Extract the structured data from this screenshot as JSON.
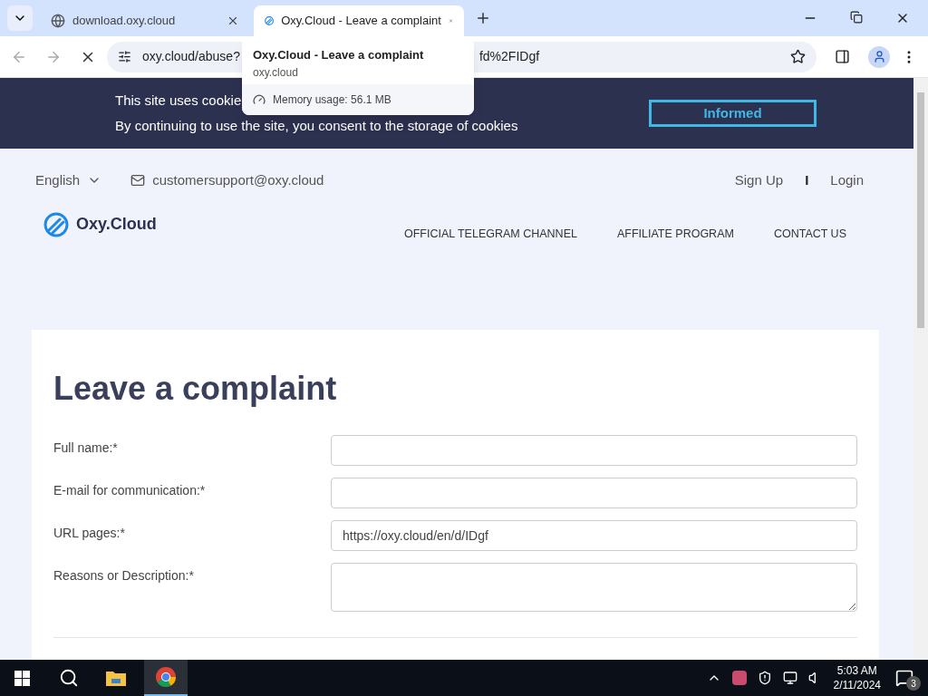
{
  "browser": {
    "tabs": [
      {
        "title": "download.oxy.cloud",
        "selected": false
      },
      {
        "title": "Oxy.Cloud - Leave a complaint",
        "selected": true
      }
    ],
    "address_start": "oxy.cloud/abuse?",
    "address_end": "fd%2FIDgf",
    "tab_preview": {
      "title": "Oxy.Cloud - Leave a complaint",
      "domain": "oxy.cloud",
      "memory": "Memory usage: 56.1 MB"
    }
  },
  "cookie_banner": {
    "line1": "This site uses cookie",
    "line2": "By continuing to use the site, you consent to the storage of cookies",
    "button": "Informed"
  },
  "header": {
    "language": "English",
    "email": "customersupport@oxy.cloud",
    "sign_up": "Sign Up",
    "separator": "I",
    "login": "Login",
    "logo": "Oxy.Cloud",
    "nav": [
      "OFFICIAL TELEGRAM CHANNEL",
      "AFFILIATE PROGRAM",
      "CONTACT US"
    ]
  },
  "form": {
    "title": "Leave a complaint",
    "fields": [
      {
        "label": "Full name:*",
        "kind": "input"
      },
      {
        "label": "E-mail for communication:*",
        "kind": "input"
      },
      {
        "label": "URL pages:*",
        "kind": "input",
        "value": "https://oxy.cloud/en/d/IDgf"
      },
      {
        "label": "Reasons or Description:*",
        "kind": "textarea"
      }
    ]
  },
  "taskbar": {
    "time": "5:03 AM",
    "date": "2/11/2024",
    "notifications": "3"
  }
}
